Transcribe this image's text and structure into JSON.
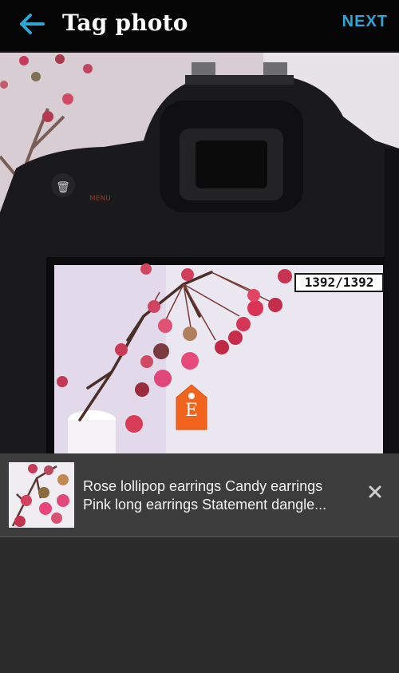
{
  "header": {
    "title": "Tag photo",
    "next_label": "NEXT",
    "back_icon": "arrow-left-icon",
    "accent": "#2ea6d6"
  },
  "photo": {
    "counter_text": "1392/1392",
    "tag": {
      "letter": "E",
      "color": "#f1641e"
    }
  },
  "listing": {
    "line1": "Rose lollipop earrings Candy earrings",
    "line2": "Pink long earrings Statement dangle...",
    "close_icon": "close-icon"
  }
}
